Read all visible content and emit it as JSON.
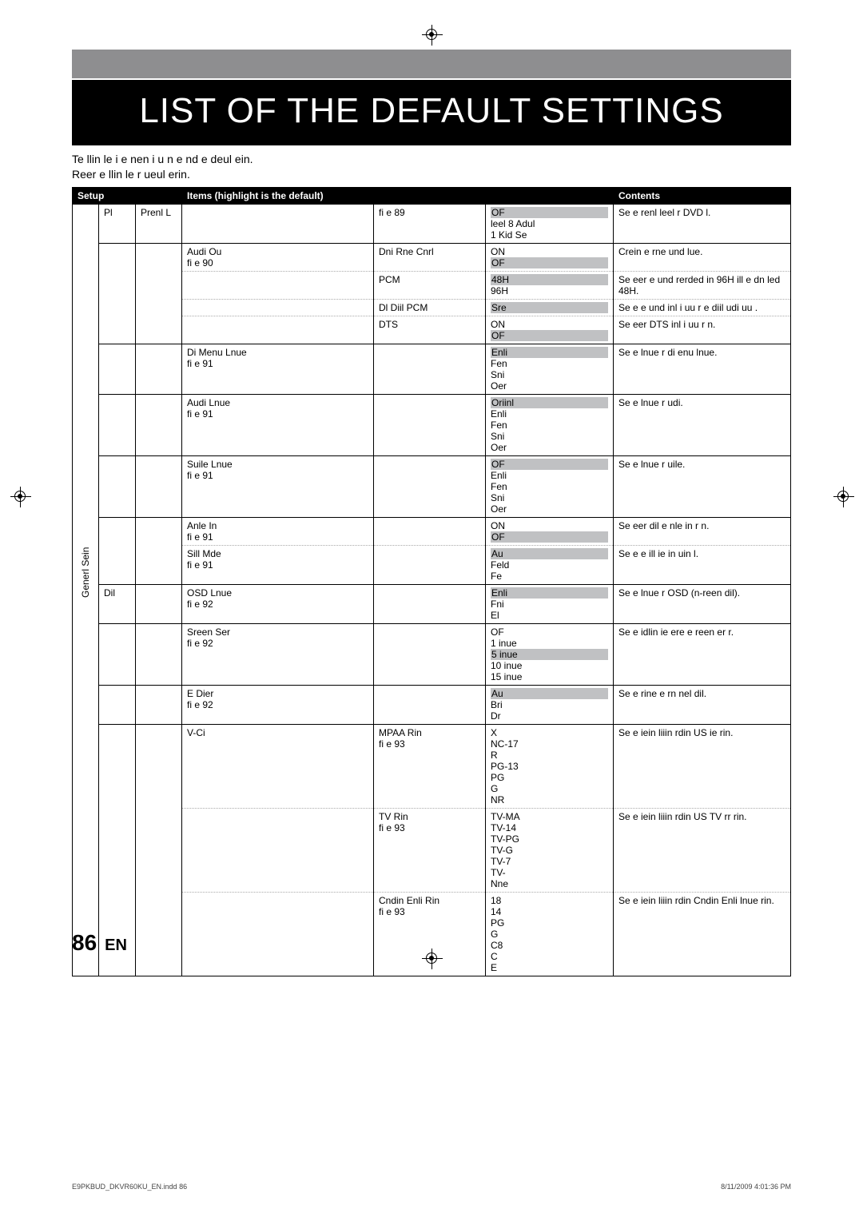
{
  "title": "LIST OF THE DEFAULT SETTINGS",
  "intro_line1": "Te llin le i e nen i u n e nd e deul ein.",
  "intro_line2": "Reer e llin le r ueul erin.",
  "headers": {
    "setup": "Setup",
    "items": "Items (highlight is the default)",
    "contents": "Contents"
  },
  "side_label": "Generl Sein",
  "rows": [
    {
      "cat1": "Pl",
      "cat2": "Prenl L",
      "item": "",
      "sub": "fi  e 89",
      "opts": [
        "OF",
        "leel 8 Adul",
        "1 Kid Se"
      ],
      "default": 0,
      "content": "Se e renl leel r DVD l.",
      "sep": true
    },
    {
      "cat1": "",
      "cat2": "",
      "item": "Audi Ou\nfi  e 90",
      "sub": "Dni Rne Cnrl",
      "opts": [
        "ON",
        "OF"
      ],
      "default": 1,
      "content": "Crein e rne  und lue."
    },
    {
      "cat1": "",
      "cat2": "",
      "item": "",
      "sub": "PCM",
      "opts": [
        "48H",
        "96H"
      ],
      "default": 0,
      "content": "Se eer e und rerded in 96H ill e dn led  48H."
    },
    {
      "cat1": "",
      "cat2": "",
      "item": "",
      "sub": "Dl Diil       PCM",
      "opts": [
        "",
        "Sre"
      ],
      "default": 1,
      "content": "Se e e  und inl i uu r e diil udi uu ."
    },
    {
      "cat1": "",
      "cat2": "",
      "item": "",
      "sub": "DTS",
      "opts": [
        "ON",
        "OF"
      ],
      "default": 1,
      "content": "Se eer DTS inl i uu r n.",
      "sep": true
    },
    {
      "cat1": "",
      "cat2": "",
      "item": "Di Menu Lnue\nfi  e 91",
      "sub": "",
      "opts": [
        "Enli",
        "Fen",
        "Sni",
        "Oer"
      ],
      "default": 0,
      "content": "Se e lnue r di enu lnue.",
      "sep": true
    },
    {
      "cat1": "",
      "cat2": "",
      "item": "Audi Lnue\nfi  e 91",
      "sub": "",
      "opts": [
        "Oriinl",
        "Enli",
        "Fen",
        "Sni",
        "Oer"
      ],
      "default": 0,
      "content": "Se e lnue r udi.",
      "sep": true
    },
    {
      "cat1": "",
      "cat2": "",
      "item": "Suile Lnue\nfi  e 91",
      "sub": "",
      "opts": [
        "OF",
        "Enli",
        "Fen",
        "Sni",
        "Oer"
      ],
      "default": 0,
      "content": "Se e lnue r uile.",
      "sep": true
    },
    {
      "cat1": "",
      "cat2": "",
      "item": "Anle In\nfi  e 91",
      "sub": "",
      "opts": [
        "ON",
        "OF"
      ],
      "default": 1,
      "content": "Se eer  dil e nle in r n."
    },
    {
      "cat1": "",
      "cat2": "",
      "item": "Sill Mde\nfi  e 91",
      "sub": "",
      "opts": [
        "Au",
        "Feld",
        "Fe"
      ],
      "default": 0,
      "content": "Se e e  ill ie in uin l.",
      "sep": true
    },
    {
      "cat1": "Dil",
      "cat2": "",
      "item": "OSD Lnue\nfi  e 92",
      "sub": "",
      "opts": [
        "Enli",
        "Fni",
        "El"
      ],
      "default": 0,
      "content": "Se e lnue r OSD (n-reen dil).",
      "sep": true
    },
    {
      "cat1": "",
      "cat2": "",
      "item": "Sreen Ser\nfi  e 92",
      "sub": "",
      "opts": [
        "OF",
        "1 inue",
        "5 inue",
        "10 inue",
        "15 inue"
      ],
      "default": 2,
      "content": "Se e idlin ie ere e reen er r.",
      "sep": true
    },
    {
      "cat1": "",
      "cat2": "",
      "item": "E Dier\nfi  e 92",
      "sub": "",
      "opts": [
        "Au",
        "Bri",
        "Dr"
      ],
      "default": 0,
      "content": "Se e rine  e rn nel dil.",
      "sep": true
    },
    {
      "cat1": "",
      "cat2": "",
      "item": "V-Ci",
      "sub": "MPAA Rin\nfi  e 93",
      "opts": [
        "X",
        "NC-17",
        "R",
        "PG-13",
        "PG",
        "G",
        "NR"
      ],
      "default": -1,
      "content": "Se e iein liiin rdin  US ie rin."
    },
    {
      "cat1": "",
      "cat2": "",
      "item": "",
      "sub": "TV Rin\nfi  e 93",
      "opts": [
        "TV-MA",
        "TV-14",
        "TV-PG",
        "TV-G",
        "TV-7",
        "TV-",
        "Nne"
      ],
      "default": -1,
      "content": "Se e iein liiin rdin  US TV rr rin."
    },
    {
      "cat1": "",
      "cat2": "",
      "item": "",
      "sub": "Cndin Enli Rin\nfi  e 93",
      "opts": [
        "18",
        "14",
        "PG",
        "G",
        "C8",
        "C",
        "E"
      ],
      "default": -1,
      "content": "Se e iein liiin rdin  Cndin Enli lnue rin.",
      "sep": true
    }
  ],
  "page_num": "86",
  "page_lang": "EN",
  "footer_left": "E9PKBUD_DKVR60KU_EN.indd   86",
  "footer_right": "8/11/2009   4:01:36 PM"
}
